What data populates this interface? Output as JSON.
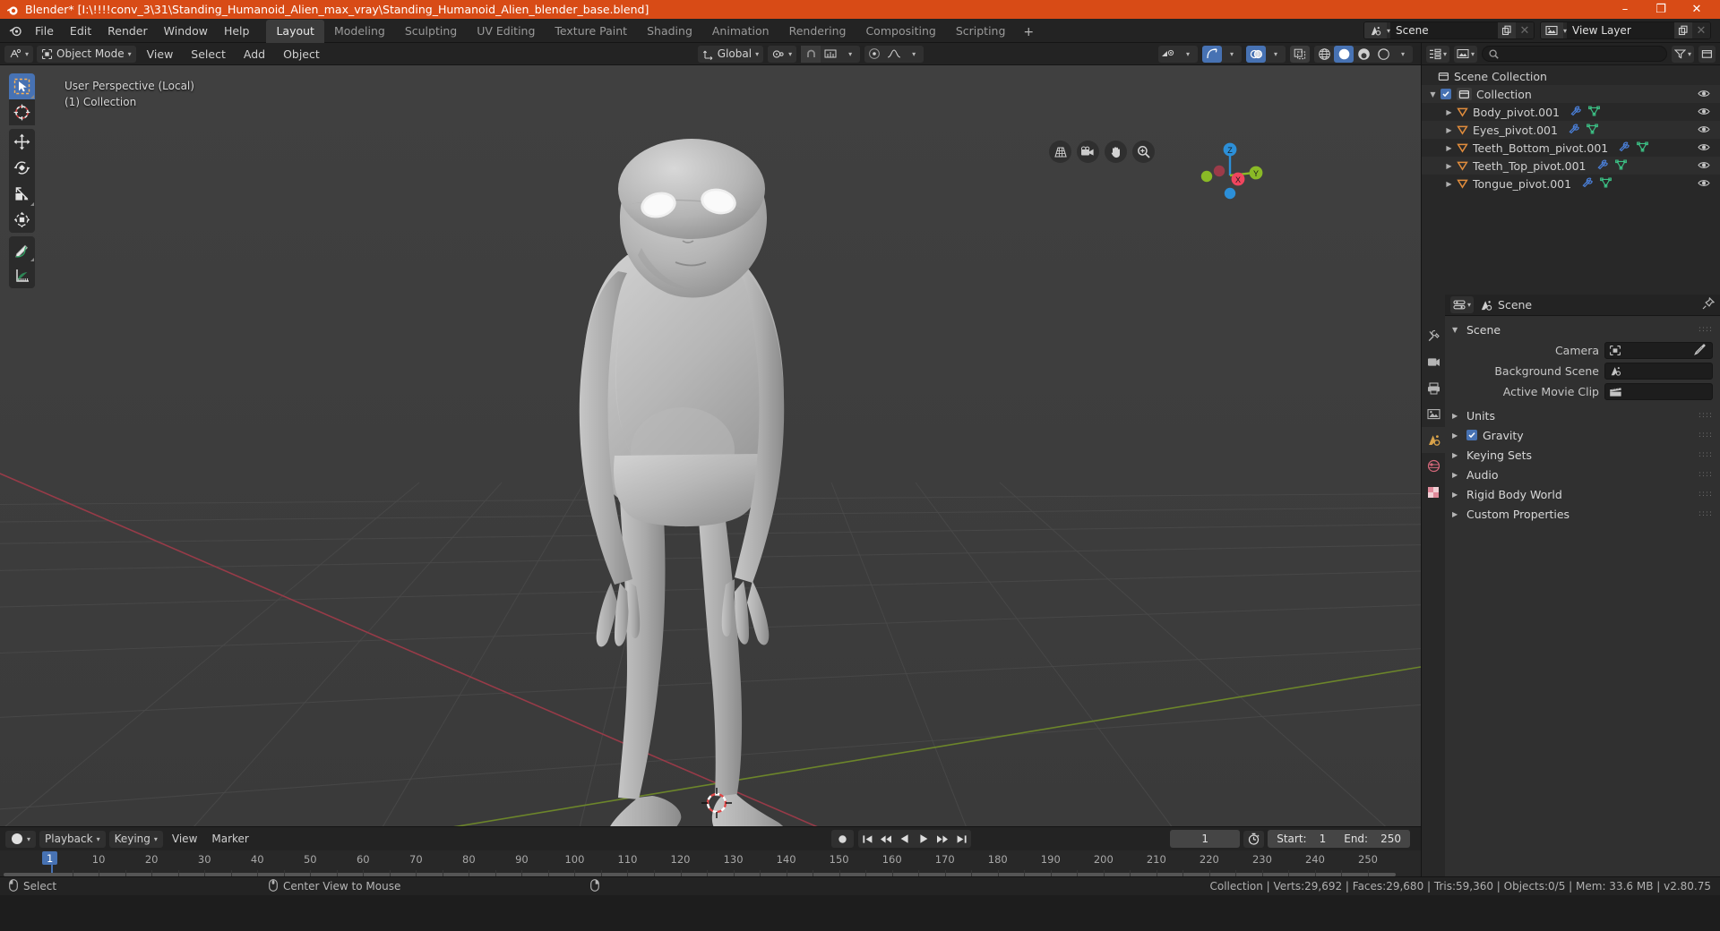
{
  "titlebar": {
    "title": "Blender* [I:\\!!!!conv_3\\31\\Standing_Humanoid_Alien_max_vray\\Standing_Humanoid_Alien_blender_base.blend]",
    "app_icon": "blender-logo-icon",
    "minimize": "–",
    "maximize": "❐",
    "close": "✕",
    "bg_color": "#d84b16"
  },
  "topbar": {
    "menus": [
      "File",
      "Edit",
      "Render",
      "Window",
      "Help"
    ],
    "workspaces": [
      {
        "label": "Layout",
        "active": true
      },
      {
        "label": "Modeling",
        "active": false
      },
      {
        "label": "Sculpting",
        "active": false
      },
      {
        "label": "UV Editing",
        "active": false
      },
      {
        "label": "Texture Paint",
        "active": false
      },
      {
        "label": "Shading",
        "active": false
      },
      {
        "label": "Animation",
        "active": false
      },
      {
        "label": "Rendering",
        "active": false
      },
      {
        "label": "Compositing",
        "active": false
      },
      {
        "label": "Scripting",
        "active": false
      }
    ],
    "add_workspace": "+",
    "scene": {
      "icon": "scene-icon",
      "name": "Scene",
      "new_btn": "new-scene-icon",
      "unlink_btn": "✕"
    },
    "view_layer": {
      "icon": "view-layer-icon",
      "name": "View Layer",
      "new_btn": "new-layer-icon",
      "unlink_btn": "✕"
    }
  },
  "viewport_header": {
    "editor_type": "editor-type-3dview-icon",
    "mode": "Object Mode",
    "menus": [
      "View",
      "Select",
      "Add",
      "Object"
    ],
    "transform_orientation": "Global",
    "pivot_icon": "pivot-point-icon",
    "snap_magnet_icon": "snap-magnet-icon",
    "snap_target_icon": "snap-increment-icon",
    "proportional_icon": "proportional-edit-icon",
    "falloff_icon": "falloff-curve-icon",
    "show_gizmo_icon": "visibility-icon",
    "gizmo_icon": "gizmo-icon",
    "overlays_icon": "overlays-icon",
    "xray_icon": "xray-icon",
    "shading_modes": [
      "wireframe",
      "solid",
      "material-preview",
      "rendered"
    ],
    "shading_active": "solid"
  },
  "viewport": {
    "overlay_line1": "User Perspective (Local)",
    "overlay_line2": "(1) Collection",
    "tools": [
      {
        "name": "tweak-select-box-tool",
        "active": true
      },
      {
        "name": "cursor-tool",
        "active": false
      },
      {
        "name": "move-tool",
        "active": false
      },
      {
        "name": "rotate-tool",
        "active": false
      },
      {
        "name": "scale-tool",
        "active": false
      },
      {
        "name": "transform-tool",
        "active": false
      },
      {
        "name": "annotate-tool",
        "active": false
      },
      {
        "name": "measure-tool",
        "active": false
      }
    ],
    "nav_icons": [
      "view-grid-icon",
      "camera-view-icon",
      "pan-view-icon",
      "zoom-view-icon"
    ],
    "gizmo_axes": [
      {
        "label": "Z",
        "color": "#2c8fd8"
      },
      {
        "label": "X",
        "color": "#f0455e"
      },
      {
        "label": "Y",
        "color": "#8aba26"
      }
    ]
  },
  "outliner": {
    "editor_type": "editor-type-outliner-icon",
    "display_mode": "view-layer-icon",
    "search_placeholder": "",
    "filter_icon": "filter-icon",
    "new_collection_icon": "new-collection-icon",
    "rows": [
      {
        "label": "Scene Collection",
        "indent": 0,
        "icon": "collection-icon",
        "disclosure": "",
        "checkbox": false,
        "extra_icons": [],
        "eye": false
      },
      {
        "label": "Collection",
        "indent": 1,
        "icon": "collection-icon",
        "disclosure": "▼",
        "checkbox": true,
        "extra_icons": [],
        "eye": true
      },
      {
        "label": "Body_pivot.001",
        "indent": 2,
        "icon": "empty-object-icon",
        "disclosure": "▶",
        "checkbox": false,
        "extra_icons": [
          "modifier-icon",
          "mesh-data-icon"
        ],
        "eye": true
      },
      {
        "label": "Eyes_pivot.001",
        "indent": 2,
        "icon": "empty-object-icon",
        "disclosure": "▶",
        "checkbox": false,
        "extra_icons": [
          "modifier-icon",
          "mesh-data-icon"
        ],
        "eye": true
      },
      {
        "label": "Teeth_Bottom_pivot.001",
        "indent": 2,
        "icon": "empty-object-icon",
        "disclosure": "▶",
        "checkbox": false,
        "extra_icons": [
          "modifier-icon",
          "mesh-data-icon"
        ],
        "eye": true
      },
      {
        "label": "Teeth_Top_pivot.001",
        "indent": 2,
        "icon": "empty-object-icon",
        "disclosure": "▶",
        "checkbox": false,
        "extra_icons": [
          "modifier-icon",
          "mesh-data-icon"
        ],
        "eye": true
      },
      {
        "label": "Tongue_pivot.001",
        "indent": 2,
        "icon": "empty-object-icon",
        "disclosure": "▶",
        "checkbox": false,
        "extra_icons": [
          "modifier-icon",
          "mesh-data-icon"
        ],
        "eye": true
      }
    ]
  },
  "properties": {
    "editor_type": "editor-type-properties-icon",
    "breadcrumb_icon": "scene-properties-icon",
    "breadcrumb": "Scene",
    "pin_icon": "pin-icon",
    "tabs": [
      {
        "name": "tool-tab",
        "icon": "tool-icon",
        "active": false
      },
      {
        "name": "render-tab",
        "icon": "render-icon",
        "active": false
      },
      {
        "name": "output-tab",
        "icon": "output-printer-icon",
        "active": false
      },
      {
        "name": "view-layer-tab",
        "icon": "view-layer-images-icon",
        "active": false
      },
      {
        "name": "scene-tab",
        "icon": "scene-cone-icon",
        "active": true
      },
      {
        "name": "world-tab",
        "icon": "world-globe-icon",
        "active": false
      },
      {
        "name": "texture-tab",
        "icon": "texture-checker-icon",
        "active": false
      }
    ],
    "panel_title": "Scene",
    "fields": [
      {
        "label": "Camera",
        "value": "",
        "icon": "camera-object-icon",
        "eyedropper": true
      },
      {
        "label": "Background Scene",
        "value": "",
        "icon": "scene-icon",
        "eyedropper": false
      },
      {
        "label": "Active Movie Clip",
        "value": "",
        "icon": "movie-clip-icon",
        "eyedropper": false
      }
    ],
    "sections": [
      {
        "label": "Units",
        "checkbox": false,
        "checked": false
      },
      {
        "label": "Gravity",
        "checkbox": true,
        "checked": true
      },
      {
        "label": "Keying Sets",
        "checkbox": false,
        "checked": false
      },
      {
        "label": "Audio",
        "checkbox": false,
        "checked": false
      },
      {
        "label": "Rigid Body World",
        "checkbox": false,
        "checked": false
      },
      {
        "label": "Custom Properties",
        "checkbox": false,
        "checked": false
      }
    ]
  },
  "timeline": {
    "editor_type": "editor-type-timeline-icon",
    "menus": [
      {
        "label": "Playback",
        "dropdown": true
      },
      {
        "label": "Keying",
        "dropdown": true
      },
      {
        "label": "View",
        "dropdown": false
      },
      {
        "label": "Marker",
        "dropdown": false
      }
    ],
    "record_icon": "auto-keying-record-icon",
    "transport": [
      "jump-to-start-icon",
      "prev-keyframe-icon",
      "play-reverse-icon",
      "play-icon",
      "next-keyframe-icon",
      "jump-to-end-icon"
    ],
    "current_frame": "1",
    "use_preview_range_icon": "stopwatch-icon",
    "start_label": "Start:",
    "start_value": "1",
    "end_label": "End:",
    "end_value": "250",
    "ruler_ticks": [
      "10",
      "20",
      "30",
      "40",
      "50",
      "60",
      "70",
      "80",
      "90",
      "100",
      "110",
      "120",
      "130",
      "140",
      "150",
      "160",
      "170",
      "180",
      "190",
      "200",
      "210",
      "220",
      "230",
      "240",
      "250"
    ],
    "playhead_label": "1"
  },
  "statusbar": {
    "items": [
      {
        "icon": "mouse-left-icon",
        "label": "Select"
      },
      {
        "icon": "mouse-middle-icon",
        "label": "Center View to Mouse"
      },
      {
        "icon": "mouse-right-icon",
        "label": ""
      }
    ],
    "stats": "Collection | Verts:29,692 | Faces:29,680 | Tris:59,360 | Objects:0/5 | Mem: 33.6 MB | v2.80.75"
  }
}
